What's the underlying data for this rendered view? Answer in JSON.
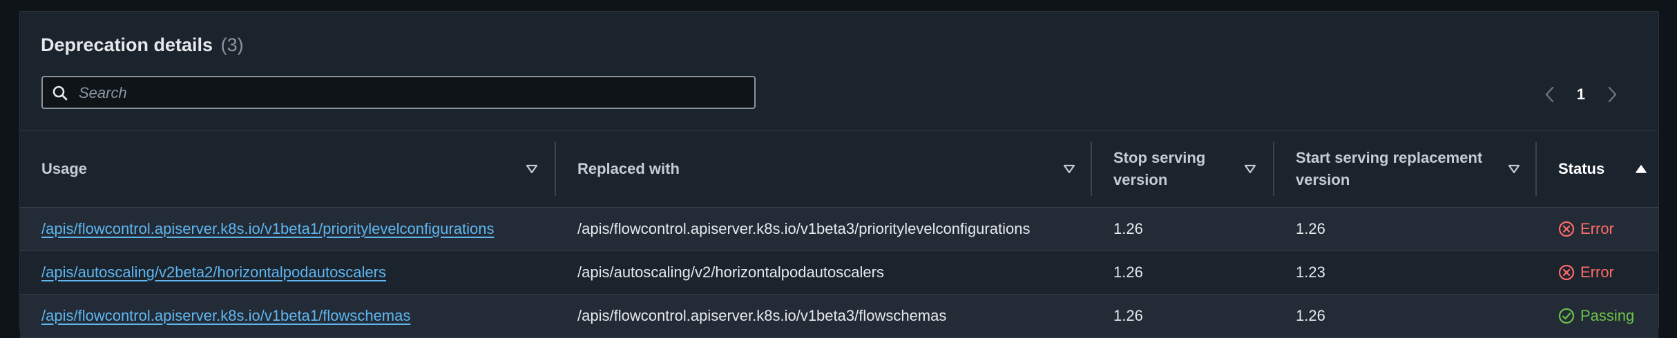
{
  "header": {
    "title": "Deprecation details",
    "count": "(3)"
  },
  "search": {
    "placeholder": "Search",
    "value": ""
  },
  "pagination": {
    "current_page": "1"
  },
  "table": {
    "columns": [
      {
        "label": "Usage",
        "sort": "none"
      },
      {
        "label": "Replaced with",
        "sort": "none"
      },
      {
        "label": "Stop serving version",
        "sort": "none"
      },
      {
        "label": "Start serving replacement version",
        "sort": "none"
      },
      {
        "label": "Status",
        "sort": "ascending"
      }
    ],
    "rows": [
      {
        "usage": "/apis/flowcontrol.apiserver.k8s.io/v1beta1/prioritylevelconfigurations",
        "replaced_with": "/apis/flowcontrol.apiserver.k8s.io/v1beta3/prioritylevelconfigurations",
        "stop_version": "1.26",
        "start_version": "1.26",
        "status": "Error",
        "status_type": "error"
      },
      {
        "usage": "/apis/autoscaling/v2beta2/horizontalpodautoscalers",
        "replaced_with": "/apis/autoscaling/v2/horizontalpodautoscalers",
        "stop_version": "1.26",
        "start_version": "1.23",
        "status": "Error",
        "status_type": "error"
      },
      {
        "usage": "/apis/flowcontrol.apiserver.k8s.io/v1beta1/flowschemas",
        "replaced_with": "/apis/flowcontrol.apiserver.k8s.io/v1beta3/flowschemas",
        "stop_version": "1.26",
        "start_version": "1.26",
        "status": "Passing",
        "status_type": "passing"
      }
    ]
  },
  "colors": {
    "link": "#5fb6f0",
    "error": "#ff6b6b",
    "passing": "#6cc24a",
    "panel_bg": "#1b232d",
    "page_bg": "#0f1419"
  },
  "icons": {
    "search": "search-icon",
    "prev": "chevron-left-icon",
    "next": "chevron-right-icon",
    "sort": "caret-down-outline-icon",
    "sort_active": "caret-up-filled-icon",
    "error": "error-circle-icon",
    "passing": "check-circle-icon"
  }
}
